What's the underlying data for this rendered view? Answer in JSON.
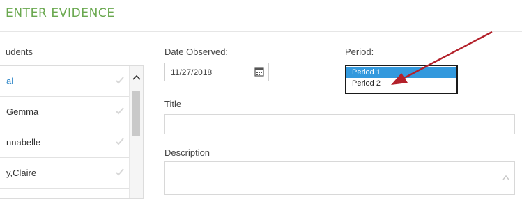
{
  "section": {
    "title": "ENTER EVIDENCE"
  },
  "students": {
    "label": "udents",
    "items": [
      {
        "name": "al",
        "active": true
      },
      {
        "name": "Gemma",
        "active": false
      },
      {
        "name": "nnabelle",
        "active": false
      },
      {
        "name": "y,Claire",
        "active": false
      }
    ]
  },
  "date_observed": {
    "label": "Date Observed:",
    "value": "11/27/2018"
  },
  "period": {
    "label": "Period:",
    "options": [
      "Period 1",
      "Period 2"
    ],
    "selected": "Period 1"
  },
  "title_field": {
    "label": "Title",
    "value": ""
  },
  "description_field": {
    "label": "Description",
    "value": ""
  },
  "colors": {
    "accent_green": "#6aa84f",
    "link_blue": "#2f87c8",
    "select_blue": "#3399dd",
    "arrow_red": "#b3202a"
  },
  "icons": {
    "calendar": "calendar-icon",
    "check": "check-icon",
    "scroll_up": "chevron-up-icon",
    "arrow": "red-pointer-arrow"
  }
}
